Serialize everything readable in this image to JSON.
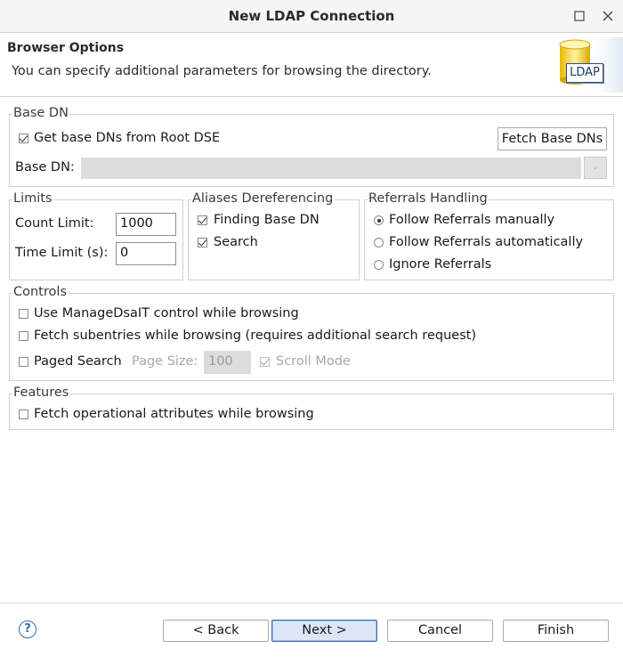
{
  "window": {
    "title": "New LDAP Connection"
  },
  "header": {
    "title": "Browser Options",
    "description": "You can specify additional parameters for browsing the directory.",
    "banner_label": "LDAP"
  },
  "base_dn": {
    "legend": "Base DN",
    "get_from_root_dse": {
      "label": "Get base DNs from Root DSE",
      "checked": true
    },
    "fetch_button": "Fetch Base DNs",
    "base_dn_label": "Base DN:",
    "base_dn_value": ""
  },
  "limits": {
    "legend": "Limits",
    "count_label": "Count Limit:",
    "count_value": "1000",
    "time_label": "Time Limit (s):",
    "time_value": "0"
  },
  "aliases": {
    "legend": "Aliases Dereferencing",
    "finding_base_dn": {
      "label": "Finding Base DN",
      "checked": true
    },
    "search": {
      "label": "Search",
      "checked": true
    }
  },
  "referrals": {
    "legend": "Referrals Handling",
    "options": [
      {
        "label": "Follow Referrals manually",
        "selected": true
      },
      {
        "label": "Follow Referrals automatically",
        "selected": false
      },
      {
        "label": "Ignore Referrals",
        "selected": false
      }
    ]
  },
  "controls": {
    "legend": "Controls",
    "manage_dsa_it": {
      "label": "Use ManageDsaIT control while browsing",
      "checked": false
    },
    "fetch_subentries": {
      "label": "Fetch subentries while browsing (requires additional search request)",
      "checked": false
    },
    "paged_search": {
      "label": "Paged Search",
      "checked": false
    },
    "page_size_label": "Page Size:",
    "page_size_value": "100",
    "scroll_mode": {
      "label": "Scroll Mode",
      "checked": true
    }
  },
  "features": {
    "legend": "Features",
    "fetch_operational": {
      "label": "Fetch operational attributes while browsing",
      "checked": false
    }
  },
  "footer": {
    "help_label": "?",
    "back": "< Back",
    "next": "Next >",
    "cancel": "Cancel",
    "finish": "Finish"
  },
  "colors": {
    "default_button_border": "#3f6fb5",
    "default_button_bg": "#dbe6f6",
    "help_icon": "#2f6db5"
  }
}
